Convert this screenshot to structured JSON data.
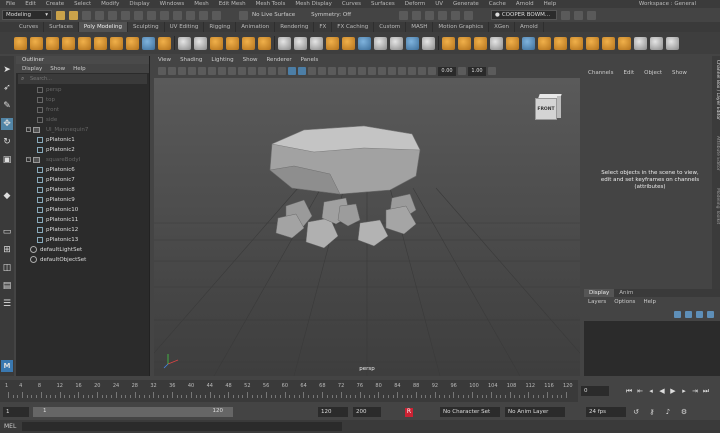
{
  "menubar": [
    "File",
    "Edit",
    "Create",
    "Select",
    "Modify",
    "Display",
    "Windows",
    "Mesh",
    "Edit Mesh",
    "Mesh Tools",
    "Mesh Display",
    "Curves",
    "Surfaces",
    "Deform",
    "UV",
    "Generate",
    "Cache",
    "Arnold",
    "Help"
  ],
  "workspace": "Workspace : General",
  "statusline": {
    "menuset": "Modeling",
    "live_surface": "No Live Surface",
    "symmetry": "Symmetry: Off",
    "user": "COOPER BOWM..."
  },
  "shelf_tabs": [
    "Curves",
    "Surfaces",
    "Poly Modeling",
    "Sculpting",
    "UV Editing",
    "Rigging",
    "Animation",
    "Rendering",
    "FX",
    "FX Caching",
    "Custom",
    "MASH",
    "Motion Graphics",
    "XGen",
    "Arnold"
  ],
  "shelf_active": "Poly Modeling",
  "outliner": {
    "title": "Outliner",
    "menu": [
      "Display",
      "Show",
      "Help"
    ],
    "search_placeholder": "Search...",
    "items": [
      {
        "label": "persp",
        "kind": "cam",
        "dim": true
      },
      {
        "label": "top",
        "kind": "cam",
        "dim": true
      },
      {
        "label": "front",
        "kind": "cam",
        "dim": true
      },
      {
        "label": "side",
        "kind": "cam",
        "dim": true
      },
      {
        "label": "UI_Mannequin7",
        "kind": "grp",
        "dim": true
      },
      {
        "label": "pPlatonic1",
        "kind": "mesh",
        "dim": false
      },
      {
        "label": "pPlatonic2",
        "kind": "mesh",
        "dim": false
      },
      {
        "label": "squareBodyI",
        "kind": "grp",
        "dim": true
      },
      {
        "label": "pPlatonic6",
        "kind": "mesh",
        "dim": false
      },
      {
        "label": "pPlatonic7",
        "kind": "mesh",
        "dim": false
      },
      {
        "label": "pPlatonic8",
        "kind": "mesh",
        "dim": false
      },
      {
        "label": "pPlatonic9",
        "kind": "mesh",
        "dim": false
      },
      {
        "label": "pPlatonic10",
        "kind": "mesh",
        "dim": false
      },
      {
        "label": "pPlatonic11",
        "kind": "mesh",
        "dim": false
      },
      {
        "label": "pPlatonic12",
        "kind": "mesh",
        "dim": false
      },
      {
        "label": "pPlatonic13",
        "kind": "mesh",
        "dim": false
      },
      {
        "label": "defaultLightSet",
        "kind": "set",
        "dim": false
      },
      {
        "label": "defaultObjectSet",
        "kind": "set",
        "dim": false
      }
    ]
  },
  "viewport": {
    "menu": [
      "View",
      "Shading",
      "Lighting",
      "Show",
      "Renderer",
      "Panels"
    ],
    "field_a": "0.00",
    "field_b": "1.00",
    "camera_label": "persp",
    "cube_label": "FRONT"
  },
  "channelbox": {
    "menu": [
      "Channels",
      "Edit",
      "Object",
      "Show"
    ],
    "message": "Select objects in the scene to view, edit and set keyframes on channels (attributes)",
    "side_tabs": [
      "Channel Box / Layer Editor",
      "Attribute Editor",
      "Modeling Toolkit"
    ]
  },
  "layer_editor": {
    "tabs": [
      "Display",
      "Anim"
    ],
    "menu": [
      "Layers",
      "Options",
      "Help"
    ]
  },
  "timeline": {
    "ticks": [
      "1",
      "4",
      "8",
      "12",
      "16",
      "20",
      "24",
      "28",
      "32",
      "36",
      "40",
      "44",
      "48",
      "52",
      "56",
      "60",
      "64",
      "68",
      "72",
      "76",
      "80",
      "84",
      "88",
      "92",
      "96",
      "100",
      "104",
      "108",
      "112",
      "116",
      "120"
    ],
    "current_frame": "0"
  },
  "range": {
    "start": "1",
    "inner_start": "1",
    "inner_end": "120",
    "end": "120",
    "anim_end": "200",
    "character_set": "No Character Set",
    "anim_layer": "No Anim Layer",
    "fps": "24 fps"
  },
  "mel_label": "MEL",
  "colors": {
    "accent": "#5285a6",
    "shelf_orange": "#e09a35",
    "bg": "#444444"
  }
}
